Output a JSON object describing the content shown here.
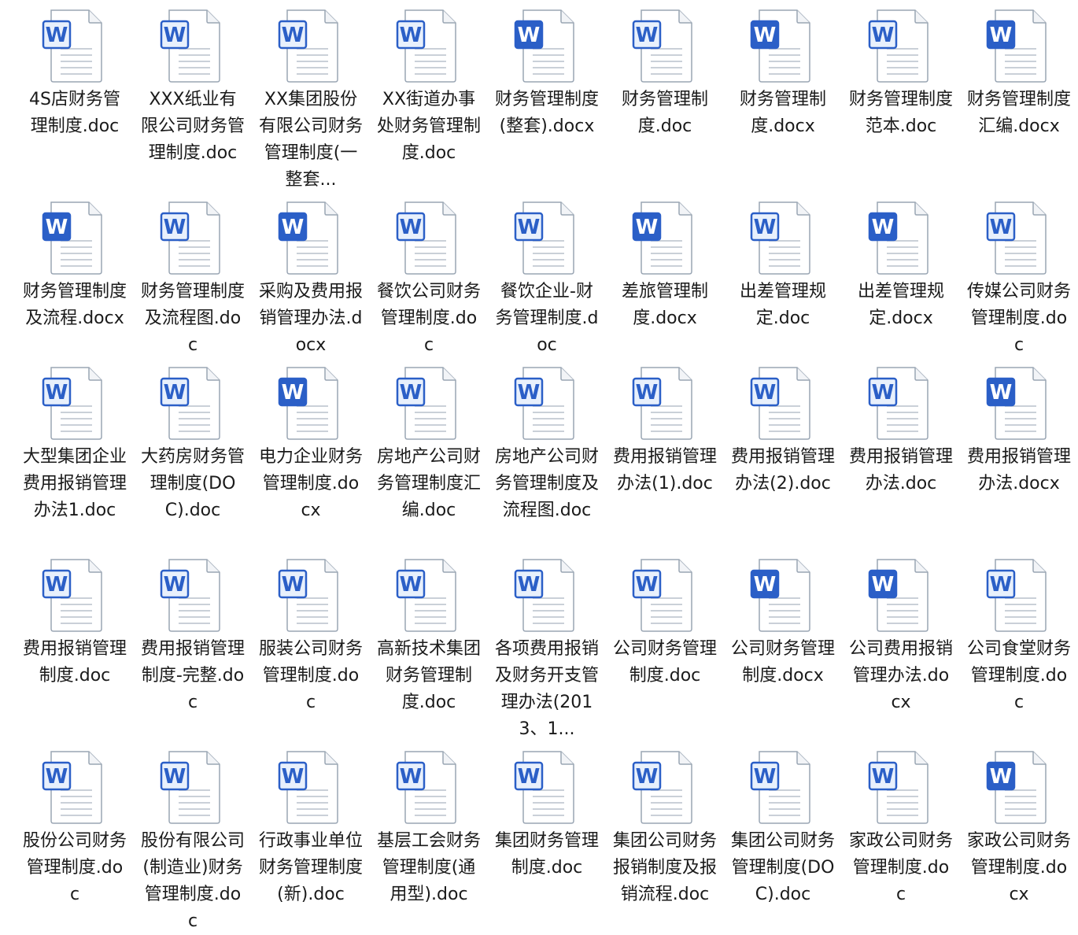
{
  "icon_color": "#2b5fc7",
  "icon_light_fill": "#e8f0fc",
  "icon_stroke": "#9aa6b4",
  "icon_name": "word-document-icon",
  "icon_glyph": "W",
  "files": [
    {
      "name": "4S店财务管理制度.doc",
      "icon_style": "light"
    },
    {
      "name": "XXX纸业有限公司财务管理制度.doc",
      "icon_style": "light"
    },
    {
      "name": "XX集团股份有限公司财务管理制度(一整套...",
      "icon_style": "light"
    },
    {
      "name": "XX街道办事处财务管理制度.doc",
      "icon_style": "light"
    },
    {
      "name": "财务管理制度(整套).docx",
      "icon_style": "filled"
    },
    {
      "name": "财务管理制度.doc",
      "icon_style": "light"
    },
    {
      "name": "财务管理制度.docx",
      "icon_style": "filled"
    },
    {
      "name": "财务管理制度范本.doc",
      "icon_style": "light"
    },
    {
      "name": "财务管理制度汇编.docx",
      "icon_style": "filled"
    },
    {
      "name": "财务管理制度及流程.docx",
      "icon_style": "filled"
    },
    {
      "name": "财务管理制度及流程图.doc",
      "icon_style": "light"
    },
    {
      "name": "采购及费用报销管理办法.docx",
      "icon_style": "filled"
    },
    {
      "name": "餐饮公司财务管理制度.doc",
      "icon_style": "light"
    },
    {
      "name": "餐饮企业-财务管理制度.doc",
      "icon_style": "light"
    },
    {
      "name": "差旅管理制度.docx",
      "icon_style": "filled"
    },
    {
      "name": "出差管理规定.doc",
      "icon_style": "light"
    },
    {
      "name": "出差管理规定.docx",
      "icon_style": "filled"
    },
    {
      "name": "传媒公司财务管理制度.doc",
      "icon_style": "light"
    },
    {
      "name": "大型集团企业费用报销管理办法1.doc",
      "icon_style": "light"
    },
    {
      "name": "大药房财务管理制度(DOC).doc",
      "icon_style": "light"
    },
    {
      "name": "电力企业财务管理制度.docx",
      "icon_style": "filled"
    },
    {
      "name": "房地产公司财务管理制度汇编.doc",
      "icon_style": "light"
    },
    {
      "name": "房地产公司财务管理制度及流程图.doc",
      "icon_style": "light"
    },
    {
      "name": "费用报销管理办法(1).doc",
      "icon_style": "light"
    },
    {
      "name": "费用报销管理办法(2).doc",
      "icon_style": "light"
    },
    {
      "name": "费用报销管理办法.doc",
      "icon_style": "light"
    },
    {
      "name": "费用报销管理办法.docx",
      "icon_style": "filled"
    },
    {
      "name": "费用报销管理制度.doc",
      "icon_style": "light"
    },
    {
      "name": "费用报销管理制度-完整.doc",
      "icon_style": "light"
    },
    {
      "name": "服装公司财务管理制度.doc",
      "icon_style": "light"
    },
    {
      "name": "高新技术集团财务管理制度.doc",
      "icon_style": "light"
    },
    {
      "name": "各项费用报销及财务开支管理办法(2013、1...",
      "icon_style": "light"
    },
    {
      "name": "公司财务管理制度.doc",
      "icon_style": "light"
    },
    {
      "name": "公司财务管理制度.docx",
      "icon_style": "filled"
    },
    {
      "name": "公司费用报销管理办法.docx",
      "icon_style": "filled"
    },
    {
      "name": "公司食堂财务管理制度.doc",
      "icon_style": "light"
    },
    {
      "name": "股份公司财务管理制度.doc",
      "icon_style": "light"
    },
    {
      "name": "股份有限公司(制造业)财务管理制度.doc",
      "icon_style": "light"
    },
    {
      "name": "行政事业单位财务管理制度(新).doc",
      "icon_style": "light"
    },
    {
      "name": "基层工会财务管理制度(通用型).doc",
      "icon_style": "light"
    },
    {
      "name": "集团财务管理制度.doc",
      "icon_style": "light"
    },
    {
      "name": "集团公司财务报销制度及报销流程.doc",
      "icon_style": "light"
    },
    {
      "name": "集团公司财务管理制度(DOC).doc",
      "icon_style": "light"
    },
    {
      "name": "家政公司财务管理制度.doc",
      "icon_style": "light"
    },
    {
      "name": "家政公司财务管理制度.docx",
      "icon_style": "filled"
    }
  ]
}
